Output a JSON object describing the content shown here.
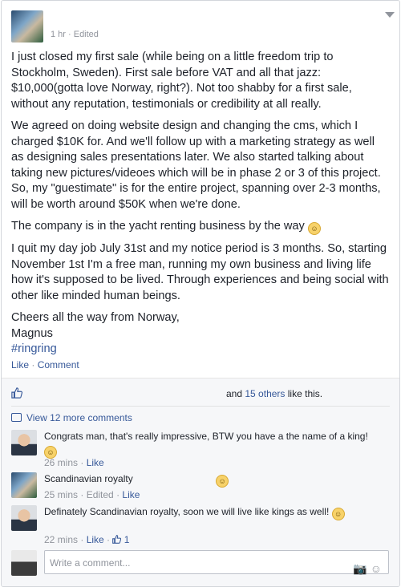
{
  "post": {
    "time": "1 hr · Edited",
    "paragraphs": [
      "I just closed my first sale (while being on a little freedom trip to Stockholm, Sweden). First sale before VAT and all that jazz: $10,000(gotta love Norway, right?). Not too shabby for a first sale, without any reputation, testimonials or credibility at all really.",
      "We agreed on doing website design and changing the cms, which I charged $10K for. And we'll follow up with a marketing strategy as well as designing sales presentations later. We also started talking about taking new pictures/videoes which will be in phase 2 or 3 of this project. So, my \"guestimate\" is for the entire project, spanning over 2-3 months, will be worth around $50K when we're done.",
      "The company is in the yacht renting business by the way",
      "I quit my day job July 31st and my notice period is 3 months. So, starting November 1st I'm a free man, running my own business and living life how it's supposed to be lived. Through experiences and being social with other like minded human beings."
    ],
    "signoff_line1": "Cheers all the way from Norway,",
    "signoff_line2": "Magnus",
    "hashtag": "#ringring"
  },
  "actions": {
    "like": "Like",
    "separator": "·",
    "comment": "Comment"
  },
  "likes": {
    "prefix": "and",
    "count_link": "15 others",
    "suffix": "like this."
  },
  "view_more": "View 12 more comments",
  "comments": [
    {
      "text": "Congrats man, that's really impressive, BTW you have a the name of a king!",
      "time": "26 mins",
      "like": "Like"
    },
    {
      "text": "Scandinavian royalty",
      "time": "25 mins",
      "edited": "Edited",
      "like": "Like"
    },
    {
      "text": "Definately Scandinavian royalty, soon we will live like kings as well!",
      "time": "22 mins",
      "like": "Like",
      "like_count": "1"
    }
  ],
  "composer": {
    "placeholder": "Write a comment..."
  },
  "colors": {
    "link": "#365899",
    "meta": "#90949c",
    "text": "#1d2129"
  },
  "icons": [
    "thumbs-up-icon",
    "comment-bubble-icon",
    "smiley-icon",
    "camera-icon",
    "emoji-icon",
    "chevron-down-icon"
  ]
}
